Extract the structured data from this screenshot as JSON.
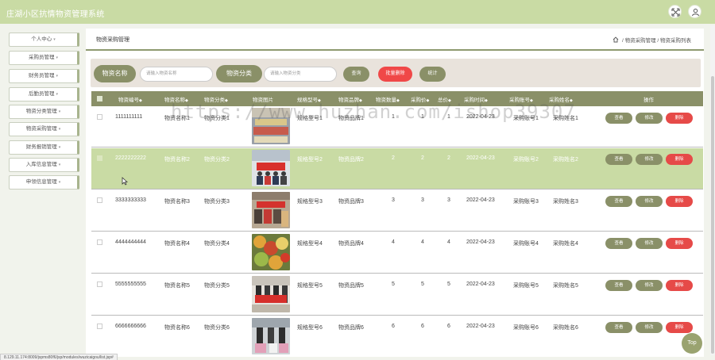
{
  "app": {
    "title": "庄湖小区抗情物资管理系统",
    "status_url": "8.129.11.174:8009/jspms80f6/jsp/modules/wuzicaigou/list.jsp#"
  },
  "colors": {
    "accent": "#8a9068",
    "header_bg": "#c9dba4",
    "danger": "#e64a48",
    "search_bg": "#e9e3dc"
  },
  "topbar": {
    "icons": [
      "fullscreen-icon",
      "user-icon"
    ]
  },
  "sidebar": {
    "items": [
      {
        "label": "个人中心"
      },
      {
        "label": "采购员管理"
      },
      {
        "label": "财务员管理"
      },
      {
        "label": "后勤员管理"
      },
      {
        "label": "物资分类管理"
      },
      {
        "label": "物资采购管理"
      },
      {
        "label": "财务报销管理"
      },
      {
        "label": "入库信息管理"
      },
      {
        "label": "申领信息管理"
      }
    ]
  },
  "page": {
    "title": "物资采购管理",
    "breadcrumb": [
      "物资采购管理",
      "物资采购列表"
    ],
    "breadcrumb_sep": "/"
  },
  "search": {
    "name_label": "物资名称",
    "name_placeholder": "请输入物资名称",
    "category_label": "物资分类",
    "category_placeholder": "请输入物资分类",
    "query_button": "查询",
    "batch_delete_button": "批量删除",
    "stats_button": "统计"
  },
  "table": {
    "columns": [
      "物资编号",
      "物资名称",
      "物资分类",
      "物资图片",
      "规格型号",
      "物资品牌",
      "物资数量",
      "采购价",
      "总价",
      "采购时间",
      "采购账号",
      "采购姓名",
      "操作"
    ],
    "sort_marker": "◆",
    "actions": {
      "view": "查看",
      "edit": "修改",
      "delete": "删除"
    },
    "rows": [
      {
        "code": "1111111111",
        "name": "物资名称1",
        "category": "物资分类1",
        "spec": "规格型号1",
        "brand": "物资品牌1",
        "qty": "1",
        "price": "1",
        "total": "1",
        "date": "2022-04-23",
        "account": "采购账号1",
        "buyer": "采购姓名1"
      },
      {
        "code": "2222222222",
        "name": "物资名称2",
        "category": "物资分类2",
        "spec": "规格型号2",
        "brand": "物资品牌2",
        "qty": "2",
        "price": "2",
        "total": "2",
        "date": "2022-04-23",
        "account": "采购账号2",
        "buyer": "采购姓名2"
      },
      {
        "code": "3333333333",
        "name": "物资名称3",
        "category": "物资分类3",
        "spec": "规格型号3",
        "brand": "物资品牌3",
        "qty": "3",
        "price": "3",
        "total": "3",
        "date": "2022-04-23",
        "account": "采购账号3",
        "buyer": "采购姓名3"
      },
      {
        "code": "4444444444",
        "name": "物资名称4",
        "category": "物资分类4",
        "spec": "规格型号4",
        "brand": "物资品牌4",
        "qty": "4",
        "price": "4",
        "total": "4",
        "date": "2022-04-23",
        "account": "采购账号4",
        "buyer": "采购姓名4"
      },
      {
        "code": "5555555555",
        "name": "物资名称5",
        "category": "物资分类5",
        "spec": "规格型号5",
        "brand": "物资品牌5",
        "qty": "5",
        "price": "5",
        "total": "5",
        "date": "2022-04-23",
        "account": "采购账号5",
        "buyer": "采购姓名5"
      },
      {
        "code": "6666666666",
        "name": "物资名称6",
        "category": "物资分类6",
        "spec": "规格型号6",
        "brand": "物资品牌6",
        "qty": "6",
        "price": "6",
        "total": "6",
        "date": "2022-04-23",
        "account": "采购账号6",
        "buyer": "采购姓名6"
      }
    ]
  },
  "top_button": "Top",
  "watermark": "https://www.huzhan.com/ishop39307"
}
